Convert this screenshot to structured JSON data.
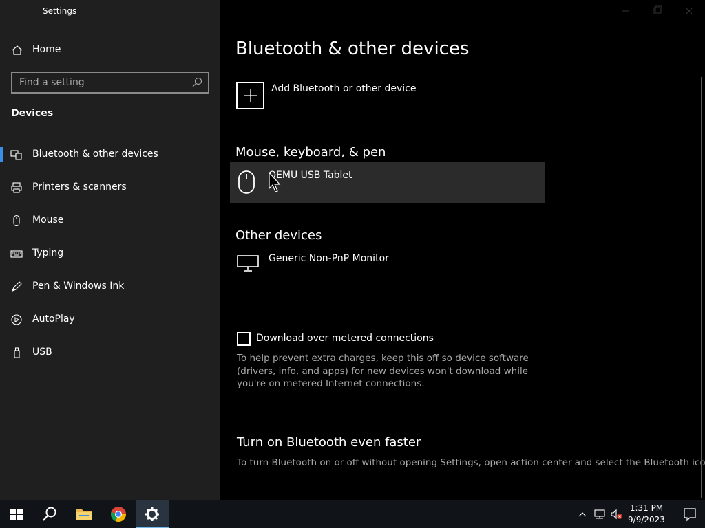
{
  "app": {
    "title": "Settings"
  },
  "sidebar": {
    "home_label": "Home",
    "search_placeholder": "Find a setting",
    "section_title": "Devices",
    "items": [
      {
        "label": "Bluetooth & other devices",
        "icon": "bluetooth-icon",
        "selected": true
      },
      {
        "label": "Printers & scanners",
        "icon": "printer-icon",
        "selected": false
      },
      {
        "label": "Mouse",
        "icon": "mouse-icon",
        "selected": false
      },
      {
        "label": "Typing",
        "icon": "keyboard-icon",
        "selected": false
      },
      {
        "label": "Pen & Windows Ink",
        "icon": "pen-icon",
        "selected": false
      },
      {
        "label": "AutoPlay",
        "icon": "autoplay-icon",
        "selected": false
      },
      {
        "label": "USB",
        "icon": "usb-icon",
        "selected": false
      }
    ]
  },
  "main": {
    "title": "Bluetooth & other devices",
    "add_device_label": "Add Bluetooth or other device",
    "groups": [
      {
        "title": "Mouse, keyboard, & pen",
        "devices": [
          {
            "name": "QEMU USB Tablet",
            "icon": "mouse-icon"
          }
        ]
      },
      {
        "title": "Other devices",
        "devices": [
          {
            "name": "Generic Non-PnP Monitor",
            "icon": "monitor-icon"
          }
        ]
      }
    ],
    "metered": {
      "label": "Download over metered connections",
      "checked": false,
      "description": "To help prevent extra charges, keep this off so device software (drivers, info, and apps) for new devices won't download while you're on metered Internet connections."
    },
    "bluetooth_faster": {
      "title": "Turn on Bluetooth even faster",
      "description": "To turn Bluetooth on or off without opening Settings, open action center and select the Bluetooth icon."
    }
  },
  "taskbar": {
    "apps": [
      {
        "icon": "windows-start-icon",
        "active": false
      },
      {
        "icon": "search-icon",
        "active": false
      },
      {
        "icon": "file-explorer-icon",
        "active": false
      },
      {
        "icon": "chrome-icon",
        "active": false
      },
      {
        "icon": "settings-gear-icon",
        "active": true
      }
    ],
    "time": "1:31 PM",
    "date": "9/9/2023"
  },
  "colors": {
    "accent": "#3a8ee6",
    "sidebar_bg": "#1f1f1f",
    "main_bg": "#000000",
    "taskbar_bg": "#101418"
  }
}
